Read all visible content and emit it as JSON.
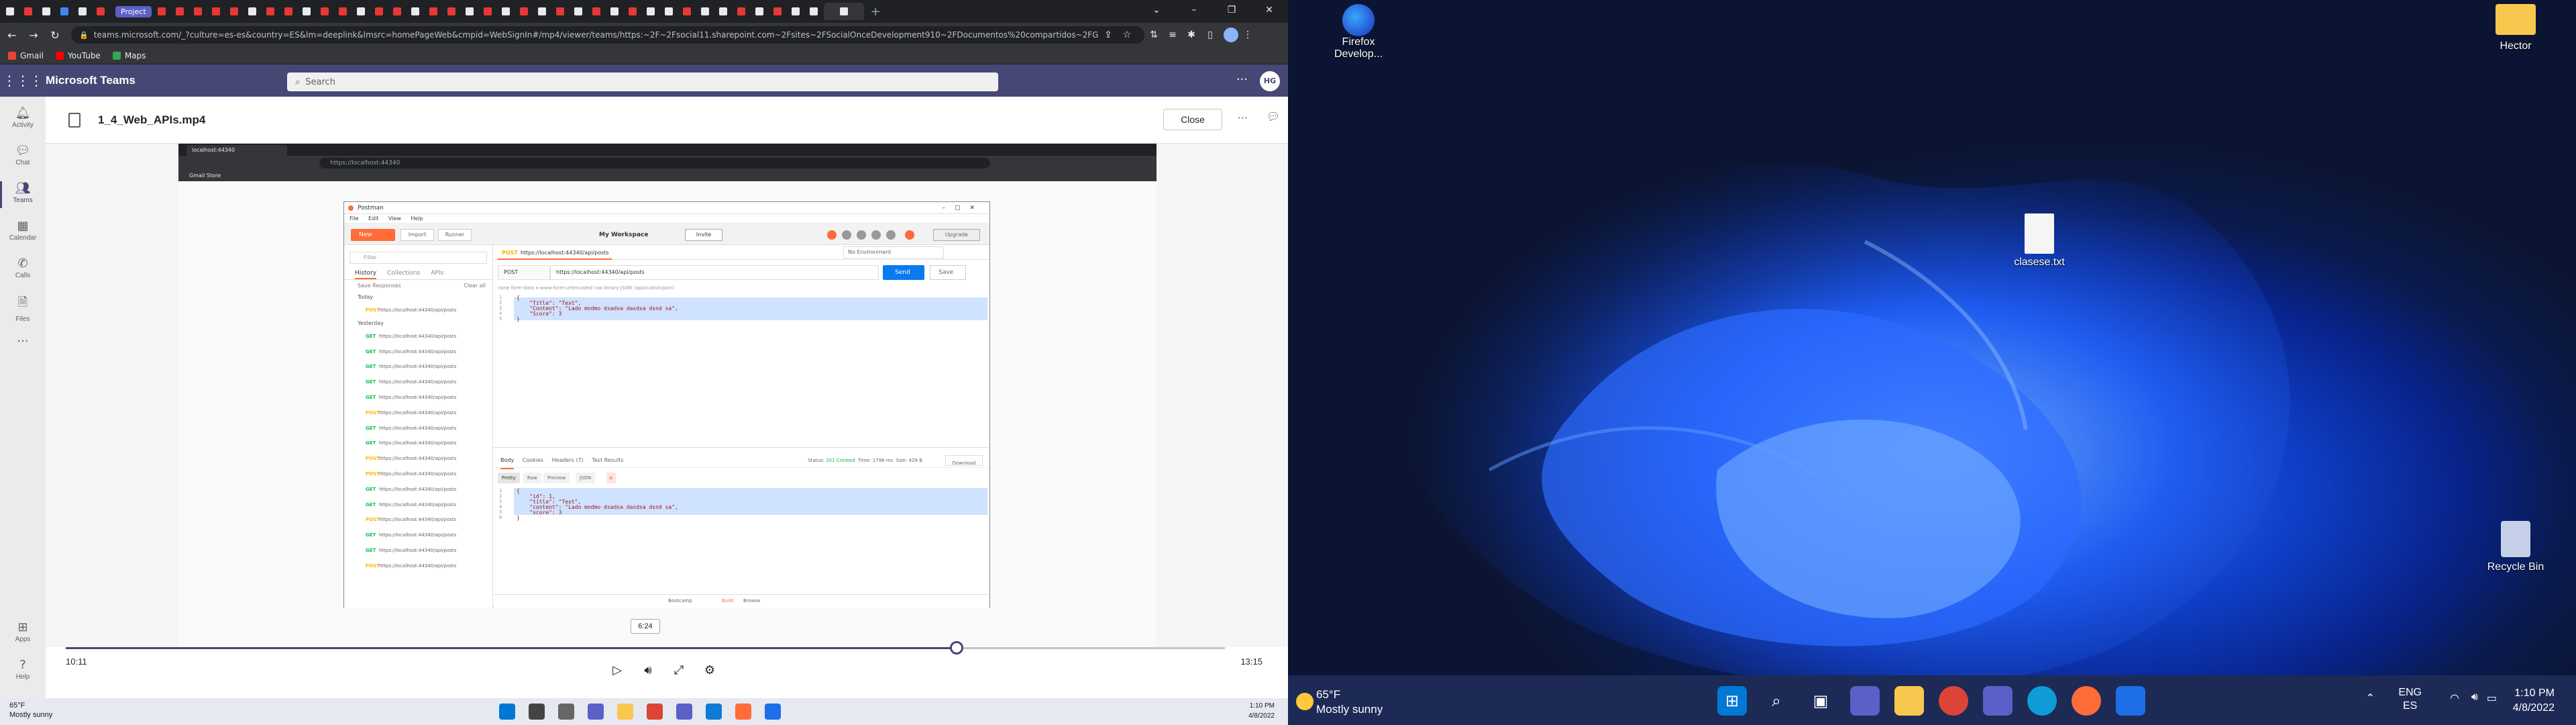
{
  "browser": {
    "url": "teams.microsoft.com/_?culture=es-es&country=ES&lm=deeplink&lmsrc=homePageWeb&cmpid=WebSignIn#/mp4/viewer/teams/https:~2F~2Fsocial11.sharepoint.com~2Fsites~2FSocialOnceDevelopment910~2FDocumentos%20compartidos~2FGener...",
    "tab_project_label": "Project",
    "bookmarks": [
      "Gmail",
      "YouTube",
      "Maps"
    ],
    "colors": {
      "tabstrip": "#202124",
      "toolbar": "#35363a"
    }
  },
  "teams": {
    "app_title": "Microsoft Teams",
    "search_placeholder": "Search",
    "avatar_initials": "HG",
    "rail": [
      {
        "label": "Activity",
        "icon": "bell-icon"
      },
      {
        "label": "Chat",
        "icon": "chat-icon"
      },
      {
        "label": "Teams",
        "icon": "teams-icon"
      },
      {
        "label": "Calendar",
        "icon": "calendar-icon"
      },
      {
        "label": "Calls",
        "icon": "phone-icon"
      },
      {
        "label": "Files",
        "icon": "file-icon"
      },
      {
        "label": "Apps",
        "icon": "apps-icon"
      },
      {
        "label": "Help",
        "icon": "help-icon"
      }
    ],
    "file_name": "1_4_Web_APIs.mp4",
    "close_label": "Close",
    "accent": "#464775"
  },
  "video": {
    "browser_tab": "localhost:44340",
    "browser_url": "https://localhost:44340",
    "bookmarks": "Gmail   Store",
    "postman": {
      "title": "Postman",
      "menu": [
        "File",
        "Edit",
        "View",
        "Help"
      ],
      "new_label": "New",
      "import_label": "Import",
      "runner_label": "Runner",
      "workspace_label": "My Workspace",
      "invite_label": "Invite",
      "upgrade_label": "Upgrade",
      "filter_placeholder": "Filter",
      "side_tabs": [
        "History",
        "Collections",
        "APIs"
      ],
      "save_responses": "Save Responses",
      "clear_all": "Clear all",
      "today_label": "Today",
      "yesterday_label": "Yesterday",
      "today_items": [
        {
          "method": "POST",
          "url": "https://localhost:44340/api/posts"
        }
      ],
      "yesterday_items": [
        {
          "method": "GET",
          "url": "https://localhost:44340/api/posts"
        },
        {
          "method": "GET",
          "url": "https://localhost:44340/api/posts"
        },
        {
          "method": "GET",
          "url": "https://localhost:44340/api/posts"
        },
        {
          "method": "GET",
          "url": "https://localhost:44340/api/posts"
        },
        {
          "method": "GET",
          "url": "https://localhost:44340/api/posts"
        },
        {
          "method": "POST",
          "url": "https://localhost:44340/api/posts"
        },
        {
          "method": "GET",
          "url": "https://localhost:44340/api/posts"
        },
        {
          "method": "GET",
          "url": "https://localhost:44340/api/posts"
        },
        {
          "method": "POST",
          "url": "https://localhost:44340/api/posts"
        },
        {
          "method": "POST",
          "url": "https://localhost:44340/api/posts"
        },
        {
          "method": "GET",
          "url": "https://localhost:44340/api/posts"
        },
        {
          "method": "GET",
          "url": "https://localhost:44340/api/posts"
        },
        {
          "method": "POST",
          "url": "https://localhost:44340/api/posts"
        },
        {
          "method": "GET",
          "url": "https://localhost:44340/api/posts"
        },
        {
          "method": "GET",
          "url": "https://localhost:44340/api/posts"
        },
        {
          "method": "POST",
          "url": "https://localhost:44340/api/posts"
        }
      ],
      "request_tab": "https://localhost:44340/api/posts",
      "request_tab_method": "POST",
      "environment": "No Environment",
      "method": "POST",
      "request_url": "https://localhost:44340/api/posts",
      "send_label": "Send",
      "save_label": "Save",
      "params_line": "none   form-data   x-www-form-urlencoded   raw   binary   JSON (application/json)",
      "request_body": [
        "{",
        "    \"Title\": \"Text\",",
        "    \"Content\": \"Lado mndmo dsadsa dasdsa dsnd sa\",",
        "    \"Score\": 3",
        "}"
      ],
      "response_tabs": [
        "Body",
        "Cookies",
        "Headers (7)",
        "Test Results"
      ],
      "status": "201 Created",
      "time": "1798 ms",
      "size": "429 B",
      "download_label": "Download",
      "response_views": [
        "Pretty",
        "Raw",
        "Preview",
        "JSON"
      ],
      "response_body": [
        "{",
        "    \"id\": 1,",
        "    \"title\": \"Text\",",
        "    \"content\": \"Lado mndmo dsadsa dasdsa dsnd sa\",",
        "    \"score\": 3",
        "}"
      ],
      "bootcamp_label": "Bootcamp",
      "build_label": "Build",
      "browse_label": "Browse"
    }
  },
  "player": {
    "hover_time": "6:24",
    "current_time": "10:11",
    "total_time": "13:15",
    "progress": 0.7686
  },
  "left_taskbar": {
    "temperature": "65°F",
    "weather": "Mostly sunny",
    "time": "1:10 PM",
    "date": "4/8/2022"
  },
  "desktop": {
    "icons": [
      {
        "label": "Firefox Develop...",
        "icon": "firefox-dev-icon"
      },
      {
        "label": "Hector",
        "icon": "folder-icon"
      },
      {
        "label": "clasese.txt",
        "icon": "text-file-icon"
      },
      {
        "label": "Recycle Bin",
        "icon": "recycle-bin-icon"
      }
    ],
    "taskbar": {
      "temperature": "65°F",
      "weather": "Mostly sunny",
      "lang_1": "ENG",
      "lang_2": "ES",
      "time": "1:10 PM",
      "date": "4/8/2022"
    }
  }
}
